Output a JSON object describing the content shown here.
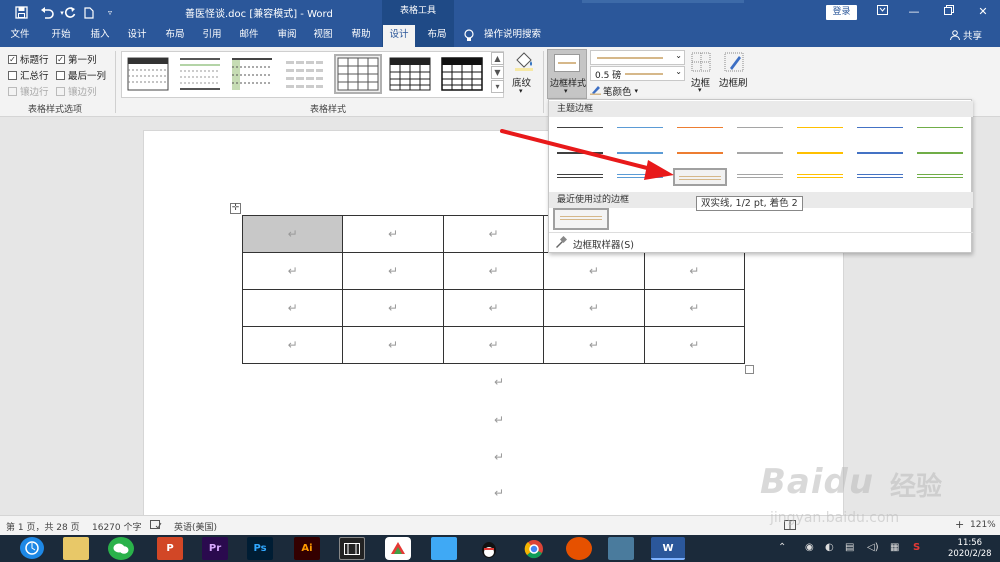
{
  "window": {
    "title": "善医怪谈.doc [兼容模式]  -  Word",
    "context_group": "表格工具",
    "login": "登录",
    "share": "共享"
  },
  "tabs": [
    "文件",
    "开始",
    "插入",
    "设计",
    "布局",
    "引用",
    "邮件",
    "审阅",
    "视图",
    "帮助",
    "设计",
    "布局"
  ],
  "active_tab_index": 10,
  "tell_me": "操作说明搜索",
  "ribbon": {
    "style_options": {
      "header_row": "标题行",
      "first_column": "第一列",
      "total_row": "汇总行",
      "last_column": "最后一列",
      "banded_rows": "镶边行",
      "banded_columns": "镶边列",
      "group_label": "表格样式选项"
    },
    "table_styles_label": "表格样式",
    "shading": "底纹",
    "border_styles": "边框样式",
    "pen_weight": "0.5 磅",
    "pen_color": "笔颜色",
    "borders": "边框",
    "border_painter": "边框刷"
  },
  "border_panel": {
    "theme_header": "主题边框",
    "recent_header": "最近使用过的边框",
    "picker": "边框取样器(S)",
    "tooltip": "双实线, 1/2 pt, 着色 2",
    "colors": [
      "#404040",
      "#5b9bd5",
      "#ed7d31",
      "#a5a5a5",
      "#ffc000",
      "#4472c4",
      "#70ad47"
    ]
  },
  "document": {
    "para_mark": "↵",
    "rows": 4,
    "cols": 5
  },
  "status": {
    "page": "第 1 页，共 28 页",
    "words": "16270 个字",
    "language": "英语(美国)",
    "zoom": "121%",
    "zoom_minus": "-",
    "zoom_plus": "+"
  },
  "taskbar": {
    "time": "11:56",
    "date": "2020/2/28",
    "apps": [
      "Pr",
      "Ps",
      "Ai"
    ]
  },
  "watermark": {
    "brand": "Baidu",
    "brand_cn": "经验",
    "url": "jingyan.baidu.com"
  }
}
